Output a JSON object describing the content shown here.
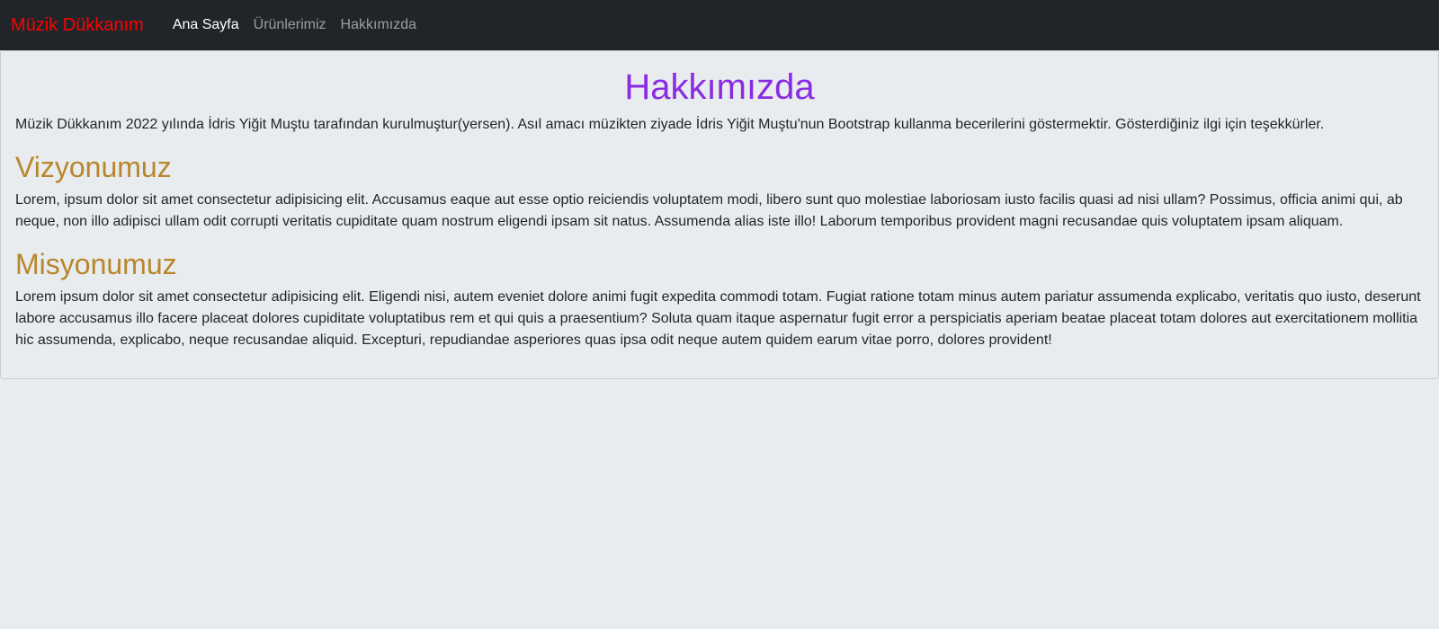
{
  "navbar": {
    "brand": "Müzik Dükkanım",
    "links": [
      {
        "label": "Ana Sayfa",
        "active": true
      },
      {
        "label": "Ürünlerimiz",
        "active": false
      },
      {
        "label": "Hakkımızda",
        "active": false
      }
    ]
  },
  "colors": {
    "navbar_bg": "#212529",
    "brand": "#ff0000",
    "page_title": "#8a2be2",
    "section_title": "#b8862b",
    "page_bg": "#e9ecef"
  },
  "main": {
    "title": "Hakkımızda",
    "intro": "Müzik Dükkanım 2022 yılında İdris Yiğit Muştu tarafından kurulmuştur(yersen). Asıl amacı müzikten ziyade İdris Yiğit Muştu'nun Bootstrap kullanma becerilerini göstermektir. Gösterdiğiniz ilgi için teşekkürler.",
    "sections": [
      {
        "title": "Vizyonumuz",
        "text": "Lorem, ipsum dolor sit amet consectetur adipisicing elit. Accusamus eaque aut esse optio reiciendis voluptatem modi, libero sunt quo molestiae laboriosam iusto facilis quasi ad nisi ullam? Possimus, officia animi qui, ab neque, non illo adipisci ullam odit corrupti veritatis cupiditate quam nostrum eligendi ipsam sit natus. Assumenda alias iste illo! Laborum temporibus provident magni recusandae quis voluptatem ipsam aliquam."
      },
      {
        "title": "Misyonumuz",
        "text": "Lorem ipsum dolor sit amet consectetur adipisicing elit. Eligendi nisi, autem eveniet dolore animi fugit expedita commodi totam. Fugiat ratione totam minus autem pariatur assumenda explicabo, veritatis quo iusto, deserunt labore accusamus illo facere placeat dolores cupiditate voluptatibus rem et qui quis a praesentium? Soluta quam itaque aspernatur fugit error a perspiciatis aperiam beatae placeat totam dolores aut exercitationem mollitia hic assumenda, explicabo, neque recusandae aliquid. Excepturi, repudiandae asperiores quas ipsa odit neque autem quidem earum vitae porro, dolores provident!"
      }
    ]
  }
}
